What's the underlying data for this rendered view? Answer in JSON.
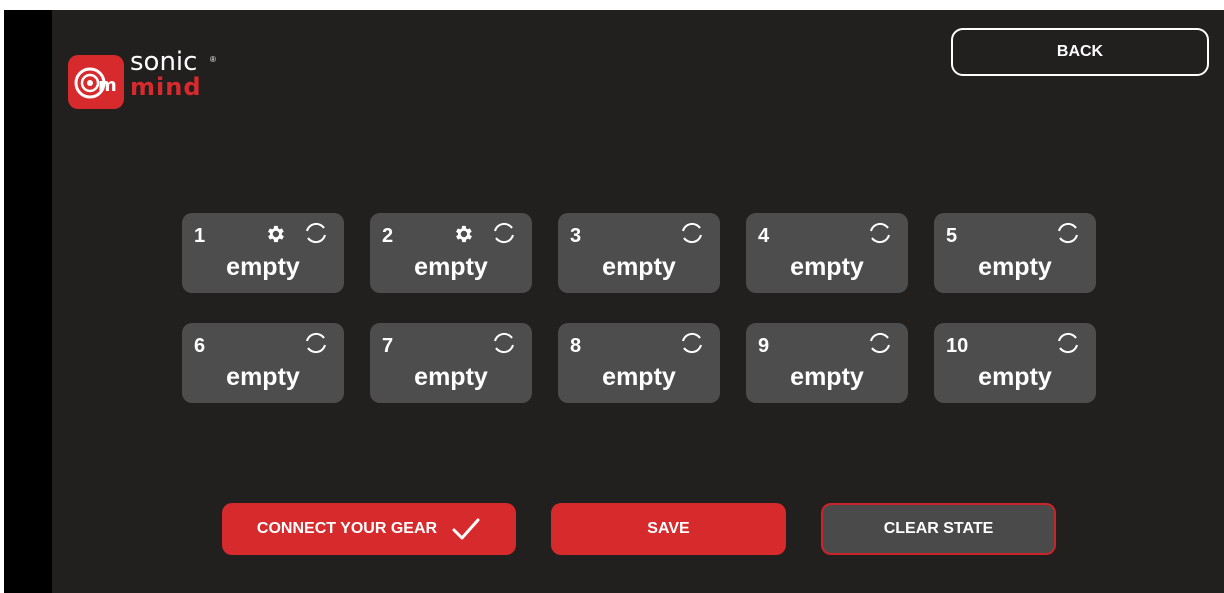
{
  "logo": {
    "word_top": "sonic",
    "word_bottom": "mind",
    "reg_mark": "®",
    "mark_letters": "sm"
  },
  "header": {
    "back_label": "BACK"
  },
  "slots": [
    {
      "number": "1",
      "state": "empty",
      "has_settings": true
    },
    {
      "number": "2",
      "state": "empty",
      "has_settings": true
    },
    {
      "number": "3",
      "state": "empty",
      "has_settings": false
    },
    {
      "number": "4",
      "state": "empty",
      "has_settings": false
    },
    {
      "number": "5",
      "state": "empty",
      "has_settings": false
    },
    {
      "number": "6",
      "state": "empty",
      "has_settings": false
    },
    {
      "number": "7",
      "state": "empty",
      "has_settings": false
    },
    {
      "number": "8",
      "state": "empty",
      "has_settings": false
    },
    {
      "number": "9",
      "state": "empty",
      "has_settings": false
    },
    {
      "number": "10",
      "state": "empty",
      "has_settings": false
    }
  ],
  "actions": {
    "connect_label": "CONNECT YOUR GEAR",
    "connect_icon": "check-icon",
    "save_label": "SAVE",
    "clear_label": "CLEAR STATE"
  },
  "colors": {
    "background": "#221f1f",
    "accent_red": "#d62a2d",
    "slot_gray": "#4d4d4d",
    "text": "#ffffff"
  }
}
